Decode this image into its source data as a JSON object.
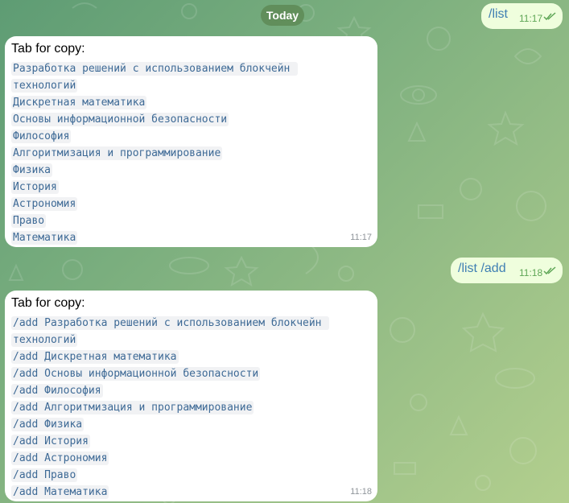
{
  "date_separator": "Today",
  "messages": [
    {
      "direction": "outgoing",
      "text": "/list",
      "time": "11:17",
      "status": "read-double-check"
    },
    {
      "direction": "incoming",
      "header": "Tab for copy:",
      "lines": [
        "Разработка решений с использованием блокчейн ",
        "технологий",
        "Дискретная математика",
        "Основы информационной безопасности",
        "Философия",
        "Алгоритмизация и программирование",
        "Физика",
        "История",
        "Астрономия",
        "Право",
        "Математика"
      ],
      "time": "11:17"
    },
    {
      "direction": "outgoing",
      "text": "/list /add",
      "time": "11:18",
      "status": "read-double-check"
    },
    {
      "direction": "incoming",
      "header": "Tab for copy:",
      "lines": [
        "/add Разработка решений с использованием блокчейн ",
        "технологий",
        "/add Дискретная математика",
        "/add Основы информационной безопасности",
        "/add Философия",
        "/add Алгоритмизация и программирование",
        "/add Физика",
        "/add История",
        "/add Астрономия",
        "/add Право",
        "/add Математика"
      ],
      "time": "11:18"
    }
  ],
  "colors": {
    "outgoing_bubble": "#effedd",
    "incoming_bubble": "#ffffff",
    "command_link": "#3f7fb3",
    "code_text": "#3e6a96",
    "read_check": "#5ea656",
    "date_pill": "#608c58"
  },
  "icons": {
    "read_status": "double-check-icon"
  }
}
